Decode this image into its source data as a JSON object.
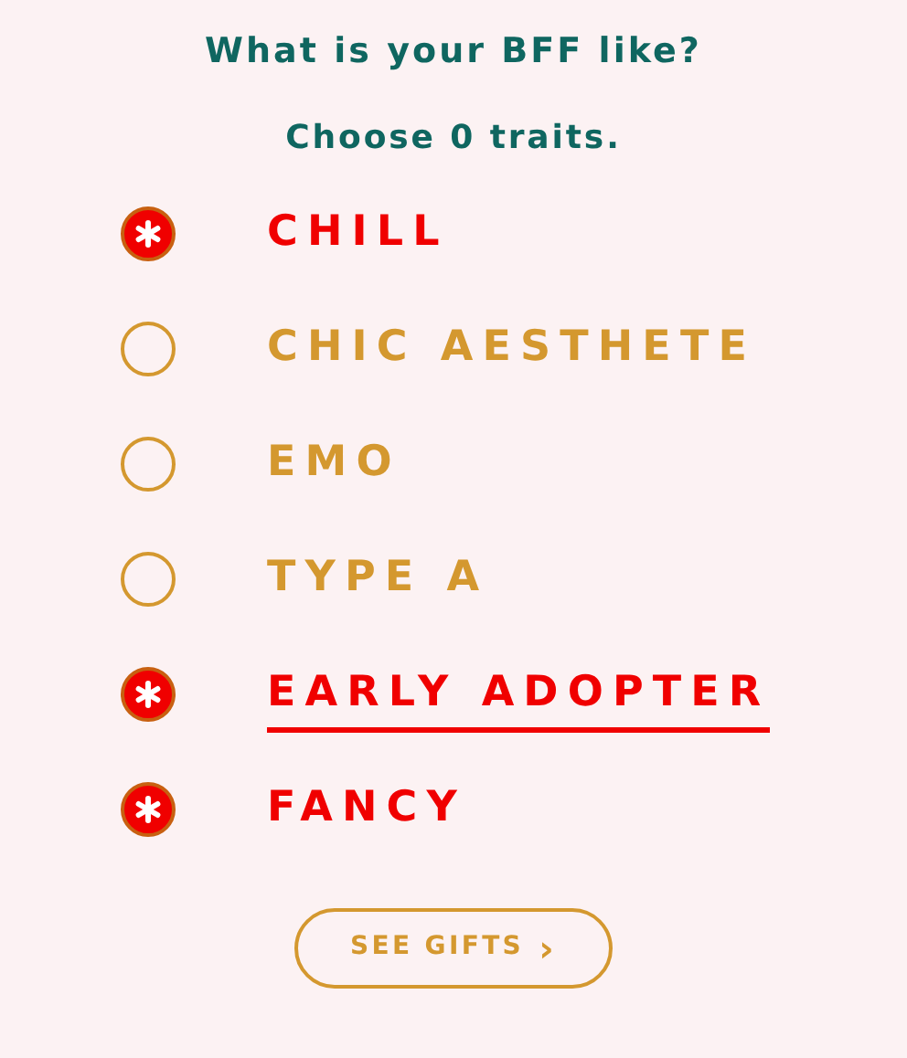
{
  "title": "What is your BFF like?",
  "subtitle": "Choose 0 traits.",
  "traits": [
    {
      "label": "CHILL",
      "checked": true,
      "focused": false
    },
    {
      "label": "CHIC AESTHETE",
      "checked": false,
      "focused": false
    },
    {
      "label": "EMO",
      "checked": false,
      "focused": false
    },
    {
      "label": "TYPE A",
      "checked": false,
      "focused": false
    },
    {
      "label": "EARLY ADOPTER",
      "checked": true,
      "focused": true
    },
    {
      "label": "FANCY",
      "checked": true,
      "focused": false
    }
  ],
  "button": {
    "label": "SEE GIFTS",
    "icon": "›"
  }
}
